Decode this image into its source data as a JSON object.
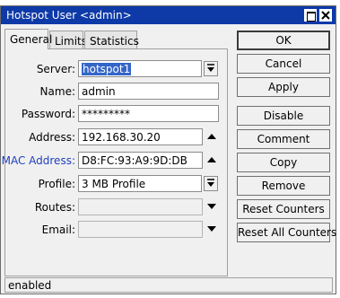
{
  "window": {
    "title": "Hotspot User <admin>"
  },
  "tabs": [
    {
      "label": "General"
    },
    {
      "label": "Limits"
    },
    {
      "label": "Statistics"
    }
  ],
  "form": {
    "server": {
      "label": "Server:",
      "value": "hotspot1"
    },
    "name": {
      "label": "Name:",
      "value": "admin"
    },
    "password": {
      "label": "Password:",
      "value": "*********"
    },
    "address": {
      "label": "Address:",
      "value": "192.168.30.20"
    },
    "mac_address": {
      "label": "MAC Address:",
      "value": "D8:FC:93:A9:9D:DB"
    },
    "profile": {
      "label": "Profile:",
      "value": "3 MB Profile"
    },
    "routes": {
      "label": "Routes:",
      "value": ""
    },
    "email": {
      "label": "Email:",
      "value": ""
    }
  },
  "buttons": {
    "ok": "OK",
    "cancel": "Cancel",
    "apply": "Apply",
    "disable": "Disable",
    "comment": "Comment",
    "copy": "Copy",
    "remove": "Remove",
    "reset_counters": "Reset Counters",
    "reset_all_counters": "Reset All Counters"
  },
  "status": {
    "text": "enabled"
  },
  "colors": {
    "titlebar": "#0e3aa8",
    "selection": "#3465c8",
    "mac_label": "#1f3fbf"
  },
  "icons": [
    "maximize-icon",
    "close-icon",
    "dropdown-arrow-icon",
    "up-arrow-icon",
    "down-arrow-icon"
  ]
}
